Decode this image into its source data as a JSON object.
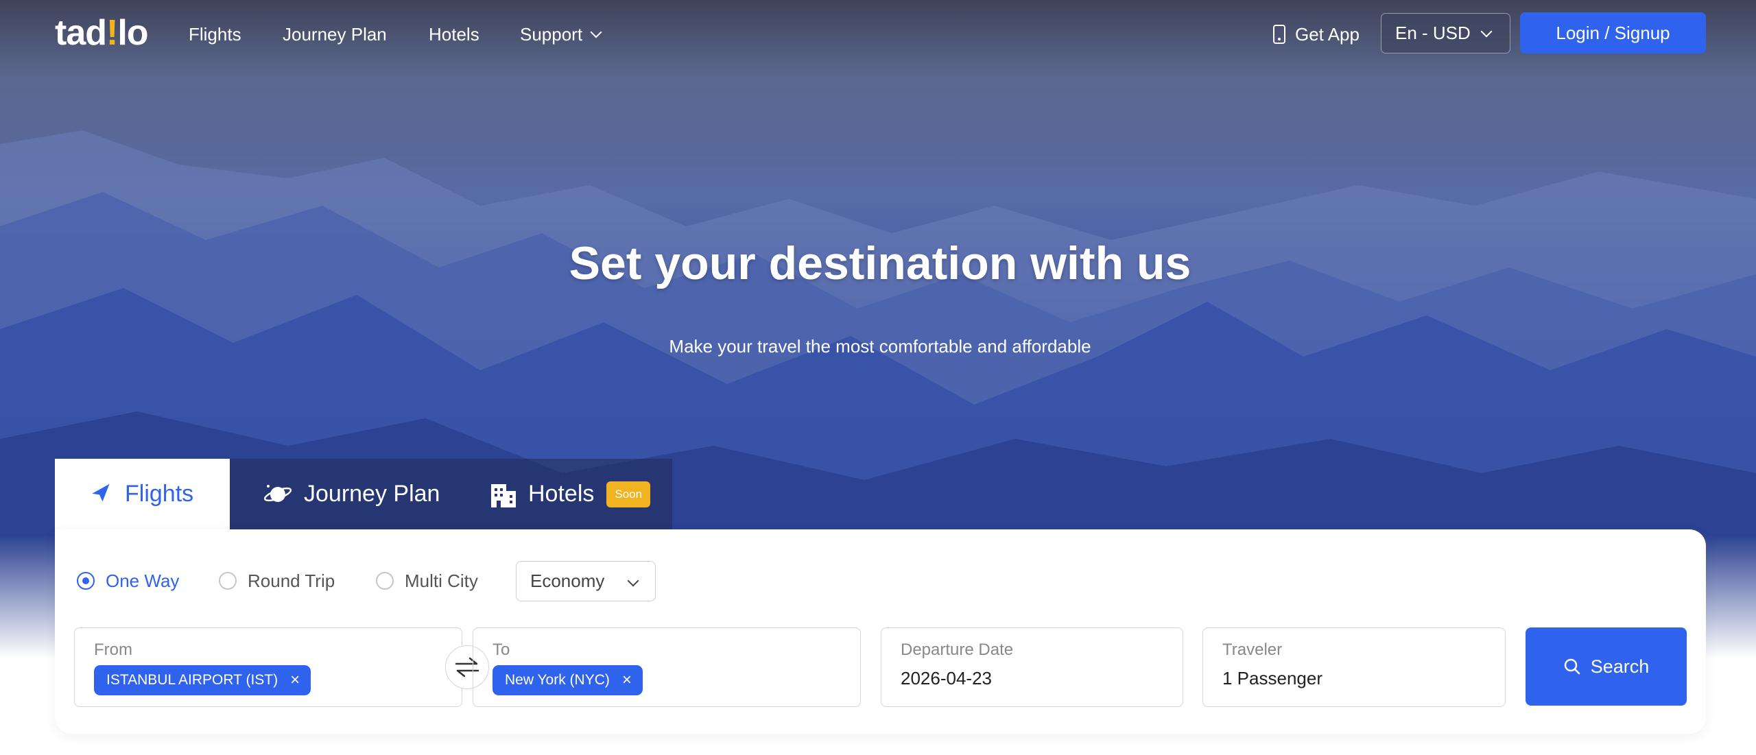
{
  "brand": {
    "logo_text_a": "tad",
    "logo_text_b": "!",
    "logo_text_c": "lo",
    "accent": "#2f63ee",
    "logo_dot": "#f2b321"
  },
  "nav": {
    "items": [
      {
        "label": "Flights"
      },
      {
        "label": "Journey Plan"
      },
      {
        "label": "Hotels"
      },
      {
        "label": "Support",
        "icon": "chevron-down-icon"
      }
    ],
    "get_app": "Get App",
    "language": "En - USD",
    "login": "Login / Signup"
  },
  "hero": {
    "title": "Set your destination with us",
    "subtitle": "Make your travel the most comfortable and affordable"
  },
  "tabs": [
    {
      "label": "Flights",
      "icon": "plane-icon",
      "active": true
    },
    {
      "label": "Journey Plan",
      "icon": "planet-icon",
      "active": false
    },
    {
      "label": "Hotels",
      "icon": "building-icon",
      "badge": "Soon",
      "active": false
    }
  ],
  "trip_types": [
    {
      "label": "One Way",
      "selected": true
    },
    {
      "label": "Round Trip",
      "selected": false
    },
    {
      "label": "Multi City",
      "selected": false
    }
  ],
  "cabin_class": "Economy",
  "search": {
    "from_label": "From",
    "from_value": "ISTANBUL AIRPORT (IST)",
    "to_label": "To",
    "to_value": "New York (NYC)",
    "departure_label": "Departure Date",
    "departure_value": "2026-04-23",
    "traveler_label": "Traveler",
    "traveler_value": "1 Passenger",
    "button": "Search"
  }
}
